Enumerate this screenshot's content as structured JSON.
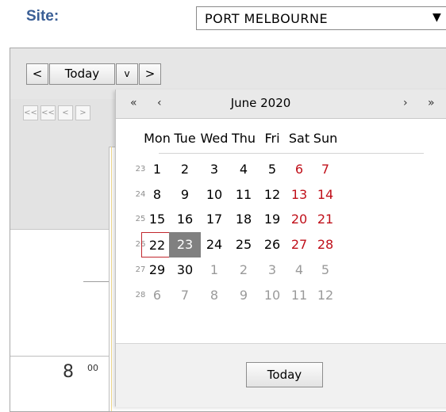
{
  "site": {
    "label": "Site:",
    "selected_value": "PORT MELBOURNE",
    "dropdown_icon": "chevron-down-icon"
  },
  "toolbar": {
    "prev_label": "<",
    "today_label": "Today",
    "dropdown_label": "v",
    "next_label": ">"
  },
  "nav_buttons": [
    "<<",
    "<<",
    "<",
    ">"
  ],
  "time_label": {
    "hour": "8",
    "minutes": "00"
  },
  "calendar": {
    "month_title": "June 2020",
    "prev_year": "«",
    "prev_month": "‹",
    "next_month": "›",
    "next_year": "»",
    "weekdays": [
      "Mon",
      "Tue",
      "Wed",
      "Thu",
      "Fri",
      "Sat",
      "Sun"
    ],
    "weeks": [
      {
        "number": "23",
        "days": [
          "1",
          "2",
          "3",
          "4",
          "5",
          "6",
          "7"
        ]
      },
      {
        "number": "24",
        "days": [
          "8",
          "9",
          "10",
          "11",
          "12",
          "13",
          "14"
        ]
      },
      {
        "number": "25",
        "days": [
          "15",
          "16",
          "17",
          "18",
          "19",
          "20",
          "21"
        ]
      },
      {
        "number": "26",
        "days": [
          "22",
          "23",
          "24",
          "25",
          "26",
          "27",
          "28"
        ]
      },
      {
        "number": "27",
        "days": [
          "29",
          "30",
          "1",
          "2",
          "3",
          "4",
          "5"
        ]
      },
      {
        "number": "28",
        "days": [
          "6",
          "7",
          "8",
          "9",
          "10",
          "11",
          "12"
        ]
      }
    ],
    "today_day": "22",
    "selected_day": "23",
    "today_button": "Today",
    "colors": {
      "weekend": "#c0101a",
      "other_month": "#9a9a9a",
      "selected_bg": "#808080",
      "today_border": "#c1272d"
    }
  }
}
